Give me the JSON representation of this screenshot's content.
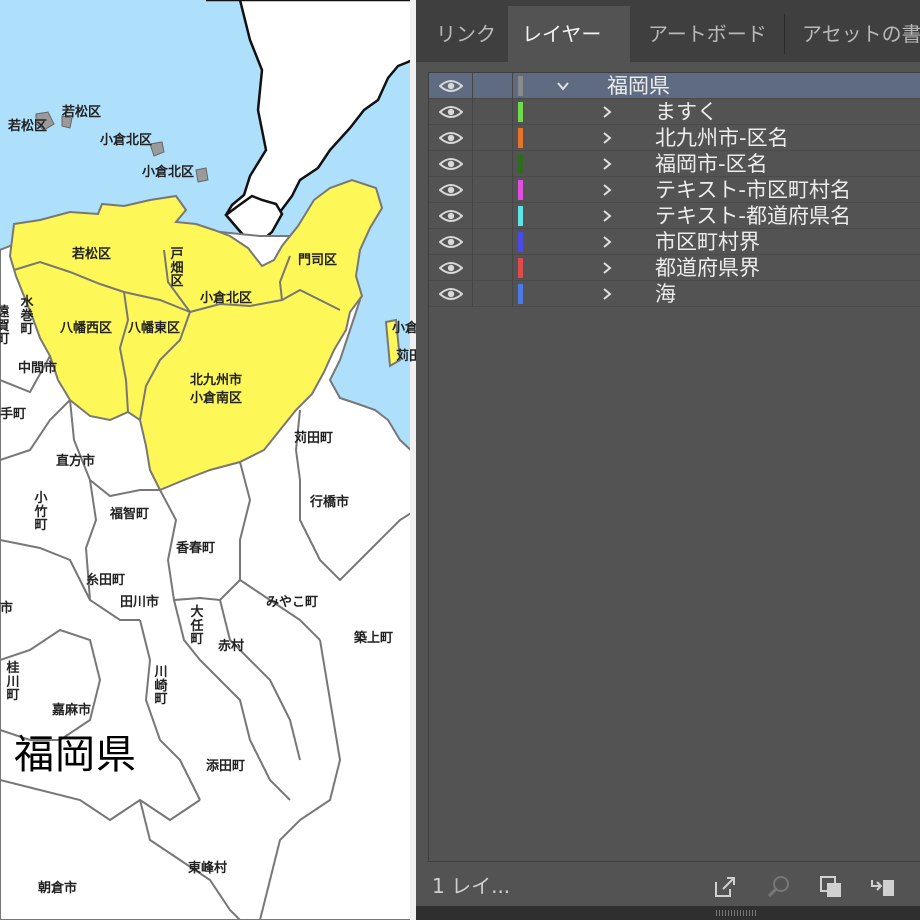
{
  "panel": {
    "tabs": [
      {
        "label": "リンク",
        "active": false
      },
      {
        "label": "レイヤー",
        "active": true
      },
      {
        "label": "アートボード",
        "active": false
      },
      {
        "label": "アセットの書",
        "active": false
      }
    ],
    "layers": [
      {
        "name": "福岡県",
        "color": "#8a8a8a",
        "expanded": true,
        "selected": true,
        "visible": true
      },
      {
        "name": "ますく",
        "color": "#6fdb4a",
        "expanded": false,
        "visible": true
      },
      {
        "name": "北九州市-区名",
        "color": "#e8742a",
        "expanded": false,
        "visible": true
      },
      {
        "name": "福岡市-区名",
        "color": "#2f6b1e",
        "expanded": false,
        "visible": true
      },
      {
        "name": "テキスト-市区町村名",
        "color": "#e04fe0",
        "expanded": false,
        "visible": true
      },
      {
        "name": "テキスト-都道府県名",
        "color": "#5fe3e3",
        "expanded": false,
        "visible": true
      },
      {
        "name": "市区町村界",
        "color": "#4a4ae8",
        "expanded": false,
        "visible": true
      },
      {
        "name": "都道府県界",
        "color": "#e04a4a",
        "expanded": false,
        "visible": true
      },
      {
        "name": "海",
        "color": "#4a7ae8",
        "expanded": false,
        "visible": true
      }
    ],
    "footer": {
      "layer_count": "1 レイ...",
      "icons": [
        "export-icon",
        "locate-object-icon",
        "make-clipping-mask-icon",
        "move-to-layer-icon"
      ]
    }
  },
  "map": {
    "colors": {
      "sea": "#aee0fc",
      "highlight": "#fdf757",
      "land": "#ffffff",
      "border": "#777777"
    },
    "labels": [
      {
        "id": "wakamatsu-island-1",
        "text": "若松区"
      },
      {
        "id": "wakamatsu-island-2",
        "text": "若松区"
      },
      {
        "id": "kokurakita-island-1",
        "text": "小倉北区"
      },
      {
        "id": "kokurakita-island-2",
        "text": "小倉北区"
      },
      {
        "id": "wakamatsu",
        "text": "若松区"
      },
      {
        "id": "tobata",
        "text": "戸畑区"
      },
      {
        "id": "moji",
        "text": "門司区"
      },
      {
        "id": "mizumaki",
        "text": "水巻町"
      },
      {
        "id": "onga",
        "text": "遠賀町"
      },
      {
        "id": "kokurakita",
        "text": "小倉北区"
      },
      {
        "id": "yahatanishi",
        "text": "八幡西区"
      },
      {
        "id": "yahatahigashi",
        "text": "八幡東区"
      },
      {
        "id": "kokura-east-edge",
        "text": "小倉"
      },
      {
        "id": "kanda-edge",
        "text": "苅田"
      },
      {
        "id": "nakama",
        "text": "中間市"
      },
      {
        "id": "kitakyushu-kokuraminami",
        "text": "北九州市\n小倉南区"
      },
      {
        "id": "kurate-edge",
        "text": "手町"
      },
      {
        "id": "kanda",
        "text": "苅田町"
      },
      {
        "id": "nogata",
        "text": "直方市"
      },
      {
        "id": "kotake",
        "text": "小竹町"
      },
      {
        "id": "yukuhashi",
        "text": "行橋市"
      },
      {
        "id": "fukuchi",
        "text": "福智町"
      },
      {
        "id": "kawara",
        "text": "香春町"
      },
      {
        "id": "itoda",
        "text": "糸田町"
      },
      {
        "id": "iizuka-edge",
        "text": "市"
      },
      {
        "id": "tagawa",
        "text": "田川市"
      },
      {
        "id": "miyako",
        "text": "みやこ町"
      },
      {
        "id": "oto",
        "text": "大任町"
      },
      {
        "id": "akamura",
        "text": "赤村"
      },
      {
        "id": "chikujo",
        "text": "築上町"
      },
      {
        "id": "keisen",
        "text": "桂川町"
      },
      {
        "id": "kawasaki",
        "text": "川崎町"
      },
      {
        "id": "kama",
        "text": "嘉麻市"
      },
      {
        "id": "fukuoka-ken",
        "text": "福岡県"
      },
      {
        "id": "soeda",
        "text": "添田町"
      },
      {
        "id": "toho",
        "text": "東峰村"
      },
      {
        "id": "asakura",
        "text": "朝倉市"
      }
    ]
  }
}
